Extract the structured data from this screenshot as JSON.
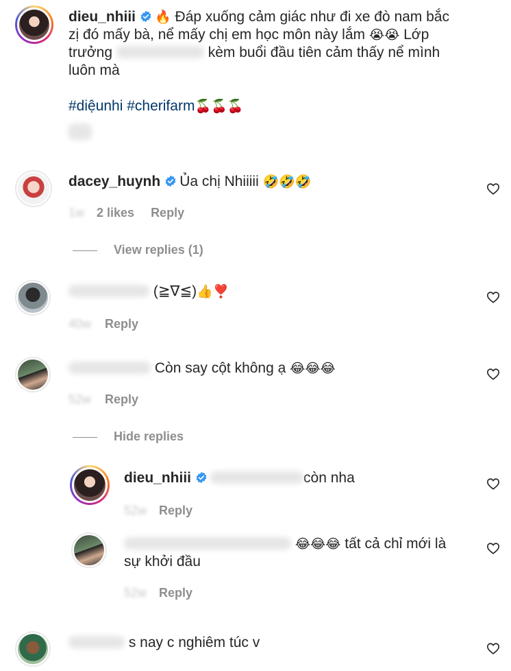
{
  "caption": {
    "username": "dieu_nhiii",
    "fire": "🔥",
    "text_line1": "Đáp xuống cảm giác như đi xe đò nam bắc",
    "text_line2": "zị đó mấy bà, nể mấy chị em học môn này lắm",
    "cry": "😭😭",
    "text_line2b": "Lớp",
    "text_line3a": "trưởng",
    "text_line3b": "kèm buổi đầu tiên cảm thấy nể mình",
    "text_line4": "luôn mà",
    "hashtags": "#diệunhi #cherifarm",
    "cherries": "🍒🍒🍒"
  },
  "comments": [
    {
      "username": "dacey_huynh",
      "text": "Ủa chị Nhiiiii",
      "emoji": "🤣🤣🤣",
      "likes": "2 likes",
      "reply_label": "Reply",
      "thread_label": "View replies (1)"
    },
    {
      "text": "(≧∇≦)",
      "emoji": "👍❣️",
      "reply_label": "Reply"
    },
    {
      "text": "Còn say cột không ạ",
      "emoji": "😂😂😂",
      "reply_label": "Reply",
      "thread_label": "Hide replies"
    }
  ],
  "replies": [
    {
      "username": "dieu_nhiii",
      "text": "còn nha",
      "reply_label": "Reply"
    },
    {
      "emoji": "😂😂😂",
      "text_line1": "tất cả chỉ mới là",
      "text_line2": "sự khởi đầu",
      "reply_label": "Reply"
    }
  ],
  "last_comment": {
    "text": "s nay c nghiêm túc v"
  },
  "icons": {
    "verified": "verified-badge-icon",
    "like": "heart-icon"
  },
  "colors": {
    "verified_blue": "#3897f0",
    "hashtag": "#00376b",
    "meta_gray": "#8e8e8e"
  }
}
